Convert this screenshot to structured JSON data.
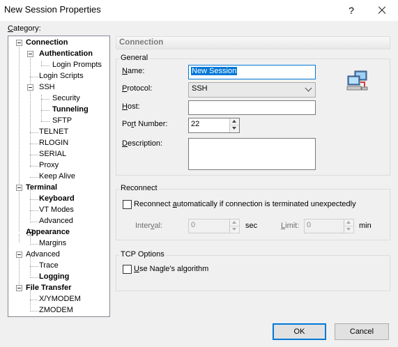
{
  "window": {
    "title": "New Session Properties",
    "help": "?"
  },
  "category_label": {
    "pre": "",
    "accel": "C",
    "post": "ategory:"
  },
  "tree": [
    {
      "label": "Connection",
      "bold": true
    },
    {
      "label": "Authentication",
      "bold": true
    },
    {
      "label": "Login Prompts",
      "bold": false
    },
    {
      "label": "Login Scripts",
      "bold": false
    },
    {
      "label": "SSH",
      "bold": false
    },
    {
      "label": "Security",
      "bold": false
    },
    {
      "label": "Tunneling",
      "bold": true
    },
    {
      "label": "SFTP",
      "bold": false
    },
    {
      "label": "TELNET",
      "bold": false
    },
    {
      "label": "RLOGIN",
      "bold": false
    },
    {
      "label": "SERIAL",
      "bold": false
    },
    {
      "label": "Proxy",
      "bold": false
    },
    {
      "label": "Keep Alive",
      "bold": false
    },
    {
      "label": "Terminal",
      "bold": true
    },
    {
      "label": "Keyboard",
      "bold": true
    },
    {
      "label": "VT Modes",
      "bold": false
    },
    {
      "label": "Advanced",
      "bold": false
    },
    {
      "label": "Appearance",
      "bold": true
    },
    {
      "label": "Margins",
      "bold": false
    },
    {
      "label": "Advanced",
      "bold": false
    },
    {
      "label": "Trace",
      "bold": false
    },
    {
      "label": "Logging",
      "bold": true
    },
    {
      "label": "File Transfer",
      "bold": true
    },
    {
      "label": "X/YMODEM",
      "bold": false
    },
    {
      "label": "ZMODEM",
      "bold": false
    }
  ],
  "panel": {
    "heading": "Connection",
    "general": {
      "title": "General",
      "name_label": {
        "accel": "N",
        "post": "ame:"
      },
      "name_value": "New Session",
      "protocol_label": {
        "accel": "P",
        "post": "rotocol:"
      },
      "protocol_value": "SSH",
      "host_label": {
        "accel": "H",
        "post": "ost:"
      },
      "host_value": "",
      "port_label": {
        "pre": "Po",
        "accel": "r",
        "post": "t Number:"
      },
      "port_value": "22",
      "description_label": {
        "accel": "D",
        "post": "escription:"
      },
      "description_value": ""
    },
    "reconnect": {
      "title": "Reconnect",
      "checkbox_label": {
        "pre": "Reconnect ",
        "accel": "a",
        "post": "utomatically if connection is terminated unexpectedly"
      },
      "checked": false,
      "interval_label": {
        "pre": "Inter",
        "accel": "v",
        "post": "al:"
      },
      "interval_value": "0",
      "interval_unit": "sec",
      "limit_label": {
        "pre": "",
        "accel": "L",
        "post": "imit:"
      },
      "limit_value": "0",
      "limit_unit": "min"
    },
    "tcp": {
      "title": "TCP Options",
      "checkbox_label": {
        "pre": "",
        "accel": "U",
        "post": "se Nagle's algorithm"
      },
      "checked": false
    }
  },
  "buttons": {
    "ok": "OK",
    "cancel": "Cancel"
  },
  "colors": {
    "accent": "#0078d7",
    "dialog_bg": "#f0f0f0"
  }
}
